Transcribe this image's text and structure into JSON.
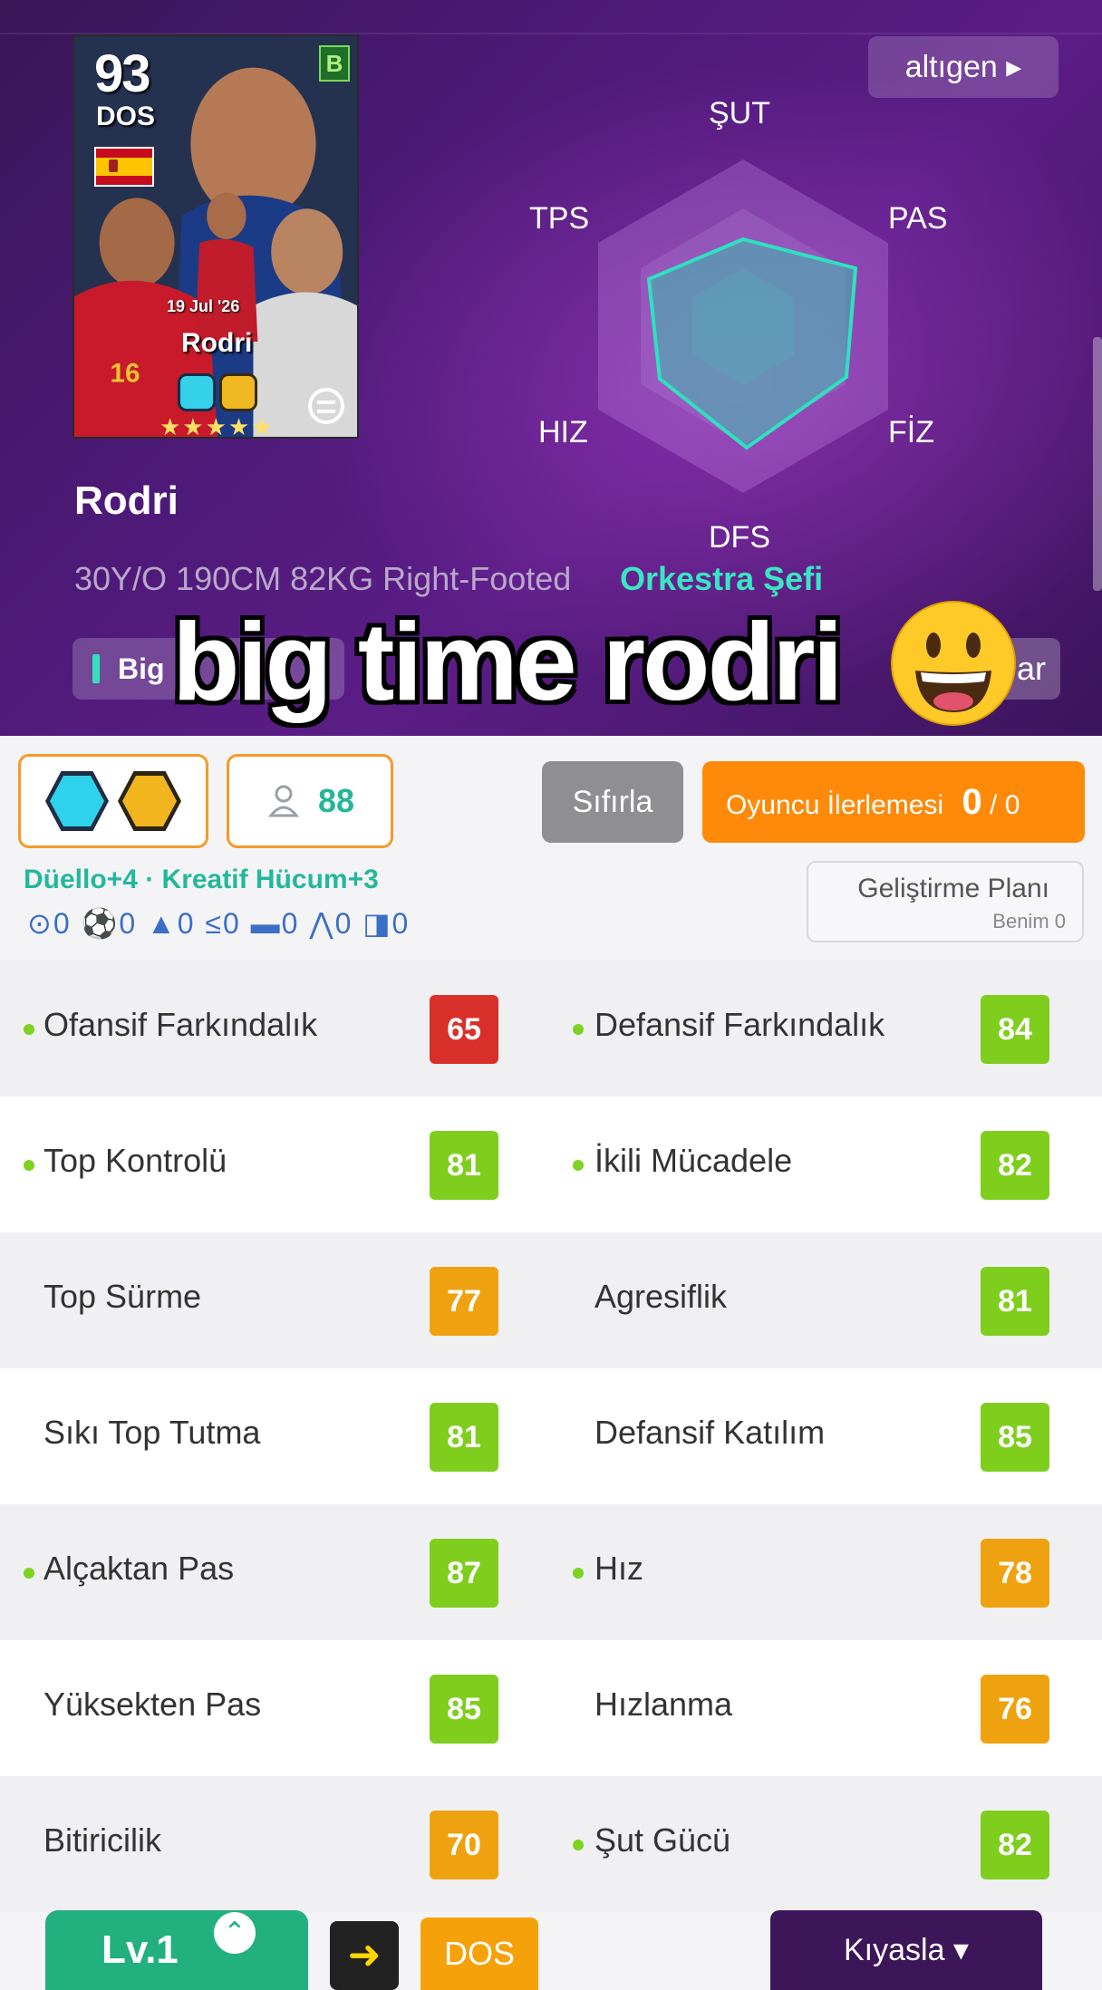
{
  "card": {
    "rating": "93",
    "position": "DOS",
    "badge": "B",
    "date": "19 Jul '26",
    "name": "Rodri",
    "stars": "★★★★★"
  },
  "radar": {
    "toggle_label": "altıgen ▸",
    "labels": {
      "top": "ŞUT",
      "top_right": "PAS",
      "bottom_right": "FİZ",
      "bottom": "DFS",
      "bottom_left": "HIZ",
      "top_left": "TPS"
    }
  },
  "player": {
    "name": "Rodri",
    "info": "30Y/O 190CM 82KG Right-Footed",
    "playing_style": "Orkestra Şefi",
    "tag_label": "Big",
    "tag_right_label": "ar"
  },
  "caption": "big time rodri",
  "controls": {
    "progress_points": "88",
    "reset_label": "Sıfırla",
    "progress_label": "Oyuncu İlerlemesi",
    "progress_current": "0",
    "progress_total": "0",
    "boosts": "Düello+4  ·  Kreatif Hücum+3",
    "indicators": "⊙0 ⚽0 ▲0 ≤0 ▬0 ⋀0 ◨0",
    "plan_title": "Geliştirme Planı",
    "plan_sub": "Benim 0"
  },
  "stats": [
    {
      "left": {
        "label": "Ofansif Farkındalık",
        "value": "65",
        "dot": true,
        "color": "#d9302c"
      },
      "right": {
        "label": "Defansif Farkındalık",
        "value": "84",
        "dot": true,
        "color": "#7fce1e"
      }
    },
    {
      "left": {
        "label": "Top Kontrolü",
        "value": "81",
        "dot": true,
        "color": "#7fce1e"
      },
      "right": {
        "label": "İkili Mücadele",
        "value": "82",
        "dot": true,
        "color": "#7fce1e"
      }
    },
    {
      "left": {
        "label": "Top Sürme",
        "value": "77",
        "dot": false,
        "color": "#efa20f"
      },
      "right": {
        "label": "Agresiflik",
        "value": "81",
        "dot": false,
        "color": "#7fce1e"
      }
    },
    {
      "left": {
        "label": "Sıkı Top Tutma",
        "value": "81",
        "dot": false,
        "color": "#7fce1e"
      },
      "right": {
        "label": "Defansif Katılım",
        "value": "85",
        "dot": false,
        "color": "#7fce1e"
      }
    },
    {
      "left": {
        "label": "Alçaktan Pas",
        "value": "87",
        "dot": true,
        "color": "#7fce1e"
      },
      "right": {
        "label": "Hız",
        "value": "78",
        "dot": true,
        "color": "#efa20f"
      }
    },
    {
      "left": {
        "label": "Yüksekten Pas",
        "value": "85",
        "dot": false,
        "color": "#7fce1e"
      },
      "right": {
        "label": "Hızlanma",
        "value": "76",
        "dot": false,
        "color": "#efa20f"
      }
    },
    {
      "left": {
        "label": "Bitiricilik",
        "value": "70",
        "dot": false,
        "color": "#efa20f"
      },
      "right": {
        "label": "Şut Gücü",
        "value": "82",
        "dot": true,
        "color": "#7fce1e"
      }
    }
  ],
  "footer": {
    "level_label": "Lv.1",
    "position_label": "DOS",
    "compare_label": "Kıyasla ▾"
  }
}
